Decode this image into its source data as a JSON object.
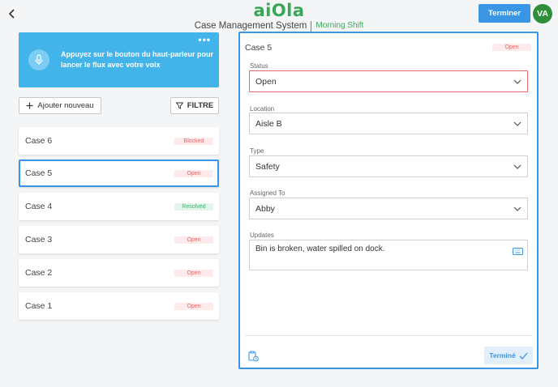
{
  "header": {
    "logo": "aiOla",
    "app_title": "Case Management System",
    "shift": "Morning Shift",
    "finish_label": "Terminer",
    "avatar_initials": "VA"
  },
  "voice_prompt": {
    "text": "Appuyez sur le bouton du haut-parleur pour lancer le flux avec votre voix",
    "menu": "•••"
  },
  "toolbar": {
    "add_label": "Ajouter nouveau",
    "filter_label": "FILTRE"
  },
  "cases": [
    {
      "name": "Case 6",
      "status": "Blocked",
      "status_type": "blocked",
      "selected": false
    },
    {
      "name": "Case 5",
      "status": "Open",
      "status_type": "open",
      "selected": true
    },
    {
      "name": "Case 4",
      "status": "Resolved",
      "status_type": "resolved",
      "selected": false
    },
    {
      "name": "Case 3",
      "status": "Open",
      "status_type": "open",
      "selected": false
    },
    {
      "name": "Case 2",
      "status": "Open",
      "status_type": "open",
      "selected": false
    },
    {
      "name": "Case 1",
      "status": "Open",
      "status_type": "open",
      "selected": false
    }
  ],
  "detail": {
    "title": "Case 5",
    "badge": "Open",
    "status_label": "Status",
    "status_value": "Open",
    "location_label": "Location",
    "location_value": "Aisle B",
    "type_label": "Type",
    "type_value": "Safety",
    "assigned_label": "Assigned To",
    "assigned_value": "Abby",
    "updates_label": "Updates",
    "updates_value": "Bin is broken, water spilled on dock.",
    "done_label": "Terminé"
  },
  "colors": {
    "accent": "#3b95e5",
    "brand": "#38a857",
    "voice_bg": "#43b4ea",
    "error": "#e46a6a"
  },
  "icons": {
    "back": "chevron-left-icon",
    "mic": "microphone-icon",
    "add": "plus-icon",
    "filter": "filter-icon",
    "dropdown": "chevron-down-icon",
    "keyboard": "keyboard-icon",
    "clipboard": "clipboard-clock-icon",
    "check": "checkmark-icon"
  }
}
